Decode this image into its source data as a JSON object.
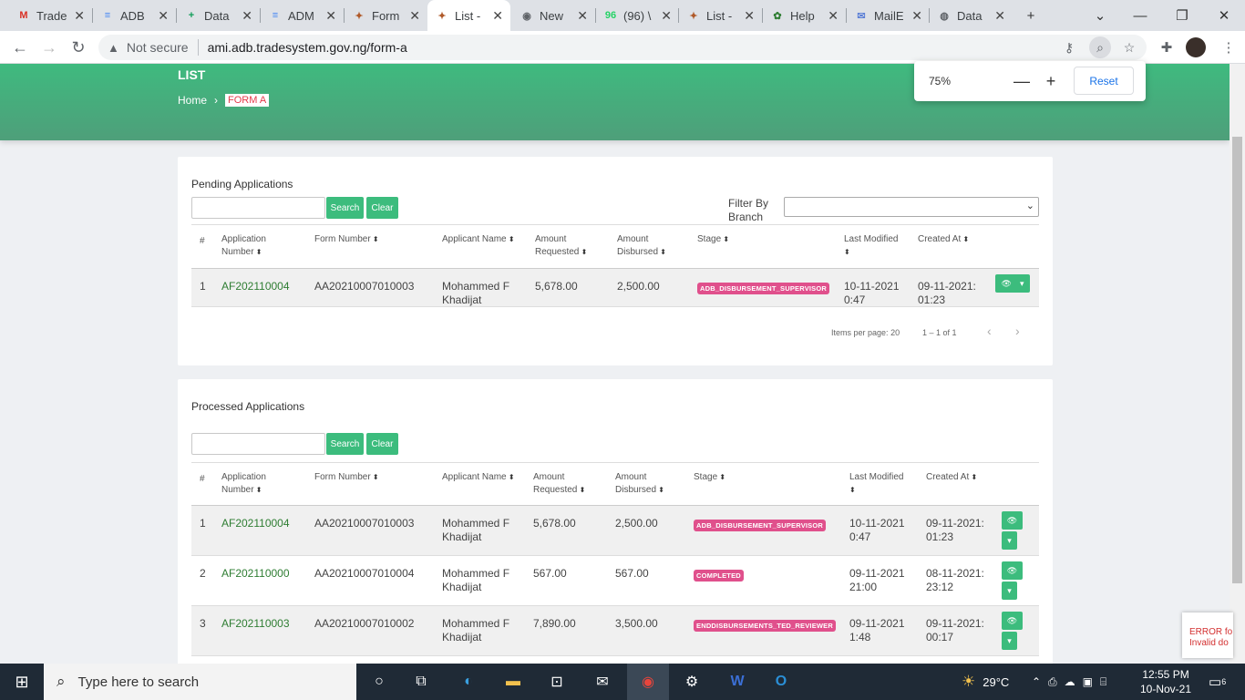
{
  "browser": {
    "tabs": [
      {
        "title": "Trade",
        "icon": "gmail-icon",
        "glyph": "M",
        "color": "#d93025"
      },
      {
        "title": "ADB",
        "icon": "docs-icon",
        "glyph": "≡",
        "color": "#4285f4"
      },
      {
        "title": "Data",
        "icon": "sheets-icon",
        "glyph": "+",
        "color": "#0f9d58"
      },
      {
        "title": "ADM",
        "icon": "docs-icon",
        "glyph": "≡",
        "color": "#4285f4"
      },
      {
        "title": "Form",
        "icon": "coat-of-arms-icon",
        "glyph": "✦",
        "color": "#b05a2a"
      },
      {
        "title": "List -",
        "icon": "coat-of-arms-icon",
        "glyph": "✦",
        "color": "#b05a2a"
      },
      {
        "title": "New",
        "icon": "chrome-icon",
        "glyph": "◉",
        "color": "#5f6368"
      },
      {
        "title": "(96) \\",
        "icon": "whatsapp-icon",
        "glyph": "96",
        "color": "#25d366"
      },
      {
        "title": "List -",
        "icon": "coat-of-arms-icon",
        "glyph": "✦",
        "color": "#b05a2a"
      },
      {
        "title": "Help",
        "icon": "help-icon",
        "glyph": "✿",
        "color": "#2e7d32"
      },
      {
        "title": "MailE",
        "icon": "mail-icon",
        "glyph": "✉",
        "color": "#5b7fd6"
      },
      {
        "title": "Data",
        "icon": "globe-icon",
        "glyph": "◍",
        "color": "#5f6368"
      }
    ],
    "active_tab": 5,
    "close_glyph": "✕",
    "new_tab": "+",
    "security_label": "Not secure",
    "url": "ami.adb.tradesystem.gov.ng/form-a",
    "zoom": {
      "value": "75%",
      "minus": "—",
      "plus": "+",
      "reset": "Reset"
    }
  },
  "page": {
    "title": "LIST",
    "breadcrumb": {
      "home": "Home",
      "sep": "›",
      "current": "FORM A"
    },
    "pending": {
      "heading": "Pending Applications",
      "search_button": "Search",
      "clear_button": "Clear",
      "filter_label_1": "Filter By",
      "filter_label_2": "Branch",
      "columns": [
        {
          "l1": "#",
          "l2": ""
        },
        {
          "l1": "Application",
          "l2": "Number"
        },
        {
          "l1": "Form Number",
          "l2": ""
        },
        {
          "l1": "Applicant Name",
          "l2": ""
        },
        {
          "l1": "Amount",
          "l2": "Requested"
        },
        {
          "l1": "Amount",
          "l2": "Disbursed"
        },
        {
          "l1": "Stage",
          "l2": ""
        },
        {
          "l1": "Last Modified",
          "l2": ""
        },
        {
          "l1": "Created At",
          "l2": ""
        }
      ],
      "rows": [
        {
          "n": "1",
          "app": "AF202110004",
          "form": "AA20210007010003",
          "name1": "Mohammed F",
          "name2": "Khadijat",
          "req": "5,678.00",
          "disb": "2,500.00",
          "stage": "ADB_DISBURSEMENT_SUPERVISOR",
          "mod1": "10-11-2021",
          "mod2": "0:47",
          "cre1": "09-11-2021:",
          "cre2": "01:23"
        }
      ],
      "pager": {
        "items_label": "Items per page:",
        "items": "20",
        "range": "1 – 1 of 1",
        "prev": "‹",
        "next": "›"
      }
    },
    "processed": {
      "heading": "Processed Applications",
      "search_button": "Search",
      "clear_button": "Clear",
      "rows": [
        {
          "n": "1",
          "app": "AF202110004",
          "form": "AA20210007010003",
          "name1": "Mohammed F",
          "name2": "Khadijat",
          "req": "5,678.00",
          "disb": "2,500.00",
          "stage": "ADB_DISBURSEMENT_SUPERVISOR",
          "mod1": "10-11-2021",
          "mod2": "0:47",
          "cre1": "09-11-2021:",
          "cre2": "01:23"
        },
        {
          "n": "2",
          "app": "AF202110000",
          "form": "AA20210007010004",
          "name1": "Mohammed F",
          "name2": "Khadijat",
          "req": "567.00",
          "disb": "567.00",
          "stage": "COMPLETED",
          "mod1": "09-11-2021",
          "mod2": "21:00",
          "cre1": "08-11-2021:",
          "cre2": "23:12"
        },
        {
          "n": "3",
          "app": "AF202110003",
          "form": "AA20210007010002",
          "name1": "Mohammed F",
          "name2": "Khadijat",
          "req": "7,890.00",
          "disb": "3,500.00",
          "stage": "ENDDISBURSEMENTS_TED_REVIEWER",
          "mod1": "09-11-2021",
          "mod2": "1:48",
          "cre1": "09-11-2021:",
          "cre2": "00:17"
        }
      ]
    },
    "error_toast": {
      "l1": "ERROR fo",
      "l2": "Invalid do"
    }
  },
  "taskbar": {
    "search_placeholder": "Type here to search",
    "weather": "29°C",
    "time": "12:55 PM",
    "date": "10-Nov-21",
    "notifications": "6"
  },
  "colors": {
    "accent": "#3cbc7d",
    "stage_pill": "#e0508c",
    "link": "#2e7d32"
  }
}
